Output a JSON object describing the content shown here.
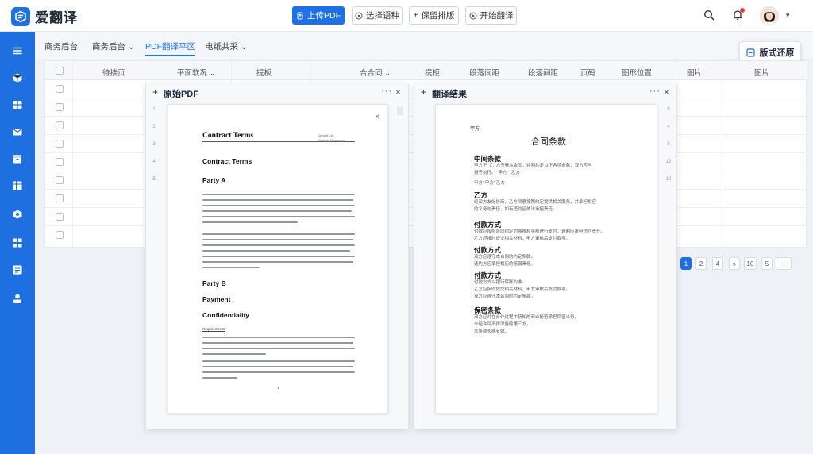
{
  "app": {
    "name": "爱翻译"
  },
  "toolbar": {
    "upload_label": "上传PDF",
    "choose_language_label": "选择语种",
    "keep_layout_label": "保留排版",
    "start_translate_label": "开始翻译"
  },
  "icons": {
    "search": "search-icon",
    "notification": "bell-icon",
    "dropdown": "chevron-down-icon"
  },
  "colors": {
    "accent": "#1f6fe5",
    "sidebar": "#1e6fe0",
    "badge": "#ee3a3a"
  },
  "sidebar": {
    "items": [
      {
        "icon": "menu-icon"
      },
      {
        "icon": "cube-icon"
      },
      {
        "icon": "grid-icon"
      },
      {
        "icon": "mail-icon"
      },
      {
        "icon": "box-icon"
      },
      {
        "icon": "table-icon"
      },
      {
        "icon": "dashboard-icon"
      },
      {
        "icon": "apps-icon"
      },
      {
        "icon": "list-icon"
      },
      {
        "icon": "user-icon"
      }
    ]
  },
  "nav": {
    "tabs": [
      {
        "label": "商务后台",
        "has_dropdown": false
      },
      {
        "label": "商务后台",
        "has_dropdown": true
      },
      {
        "label": "PDF翻译平区",
        "has_dropdown": false,
        "active": true
      },
      {
        "label": "电纸共采",
        "has_dropdown": true
      }
    ],
    "restore_label": "版式还原"
  },
  "table": {
    "headers": [
      "待接页",
      "平面软况",
      "提板",
      "合合同",
      "提柜",
      "段落间距",
      "段落间距",
      "页码",
      "图形位置",
      "图片",
      "图片"
    ]
  },
  "pagination": {
    "pages": [
      "1",
      "2",
      "4",
      "»",
      "10",
      "5",
      "···"
    ],
    "current": "1"
  },
  "left_panel": {
    "title": "原始PDF",
    "thumb_labels": [
      "1",
      "2",
      "3",
      "4",
      "5"
    ],
    "doc": {
      "heading_main": "Contract Terms",
      "header_right_1": "Service Ltd.",
      "header_right_2": "Contract Document",
      "subheading": "Contract Terms",
      "party_a": "Party A",
      "party_b": "Party B",
      "payment": "Payment",
      "confidentiality": "Confidentiality",
      "small_heading": "Requirements"
    }
  },
  "right_panel": {
    "title": "翻译结果",
    "thumb_labels": [
      "8",
      "4",
      "8",
      "12",
      "12"
    ],
    "doc": {
      "top_left": "甲方",
      "title": "合同条款",
      "sections": [
        {
          "heading": "中间条款",
          "body": "甲方于“乙”方签署本合同，特别约定以下各项条款，双方应当遵守执行。"
        },
        {
          "heading": "乙方",
          "body": "经双方友好协商，乙方同意按照约定提供相关服务，并承担相应的义务与责任。"
        },
        {
          "heading": "付款方式",
          "body": "付款应按照合同约定的期限和金额进行支付。"
        },
        {
          "heading": "保密条款",
          "body": "双方应对在合作过程中获知的商业秘密承担保密义务。"
        }
      ],
      "body_lines": [
        "甲方于“乙”方签署本合同，特别约定以下各项条款，双方应当",
        "遵守执行。“甲方”“乙方”",
        "甲方“甲方”乙方",
        "经双方友好协商，乙方同意按照约定提供相关服务，并承担相应",
        "的义务与责任，如有违约应依法承担责任。",
        "付款应按照合同约定的期限和金额进行支付，逾期应承担违约责任。",
        "乙方应按时提交相关材料，甲方审核后支付款项。",
        "双方应遵守本合同的约定条款。",
        "违约方应承担相应的赔偿责任。",
        "付款方式以银行转账为准。",
        "双方应对在合作过程中获知的商业秘密承担保密义务，",
        "未经许可不得泄露给第三方。",
        "本条款长期有效。"
      ]
    }
  }
}
